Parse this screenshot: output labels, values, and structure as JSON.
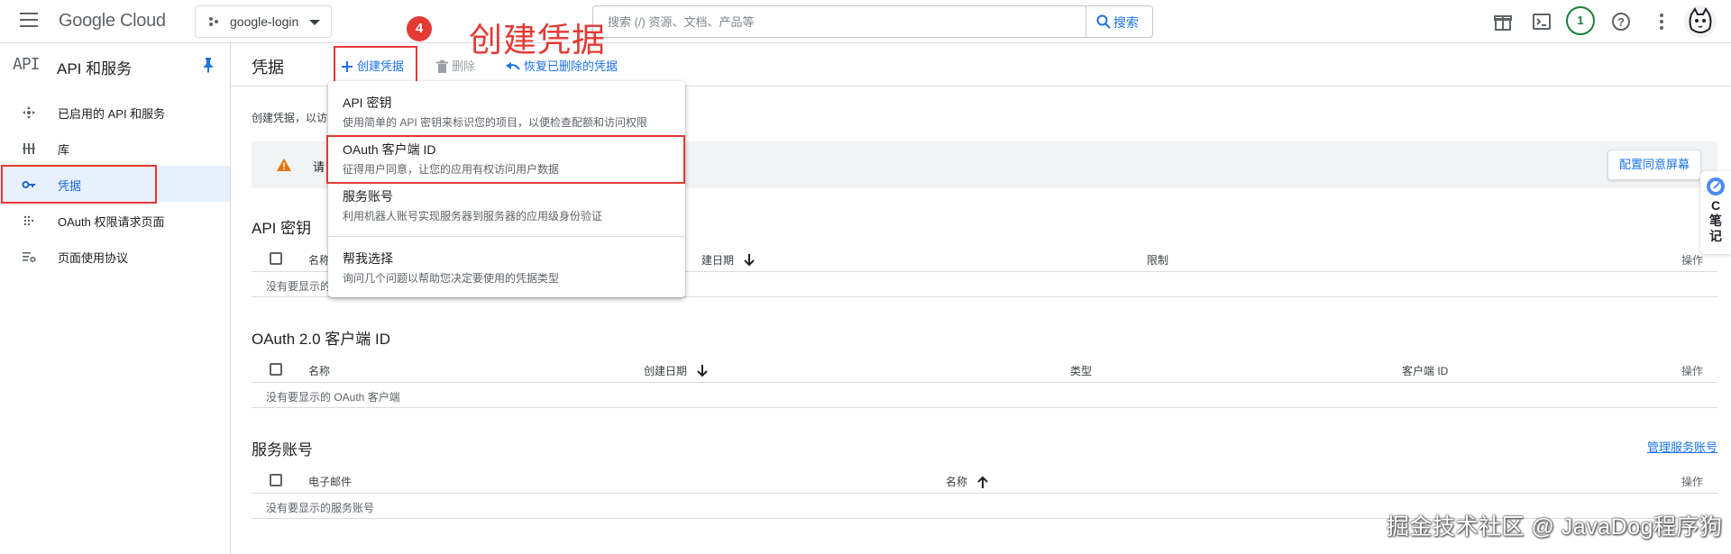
{
  "topbar": {
    "logo_google": "Google",
    "logo_cloud": "Cloud",
    "project_name": "google-login",
    "search_placeholder": "搜索 (/) 资源、文档、产品等",
    "search_button": "搜索",
    "notification_count": "1"
  },
  "sidebar": {
    "logo": "API",
    "title": "API 和服务",
    "items": [
      {
        "label": "已启用的 API 和服务",
        "icon": "diamond-arrows-icon"
      },
      {
        "label": "库",
        "icon": "library-grid-icon"
      },
      {
        "label": "凭据",
        "icon": "key-icon",
        "active": true
      },
      {
        "label": "OAuth 权限请求页面",
        "icon": "dots-grid-icon"
      },
      {
        "label": "页面使用协议",
        "icon": "settings-list-icon"
      }
    ]
  },
  "main": {
    "page_title": "凭据",
    "toolbar": {
      "create_label": "创建凭据",
      "delete_label": "删除",
      "restore_label": "恢复已删除的凭据"
    },
    "intro_text": "创建凭据，以访",
    "warning_text": "请",
    "consent_button": "配置同意屏幕",
    "api_keys": {
      "title": "API 密钥",
      "columns": [
        "名称",
        "建日期",
        "限制"
      ],
      "ops": "操作",
      "empty": "没有要显示的"
    },
    "oauth": {
      "title": "OAuth 2.0 客户端 ID",
      "columns": [
        "名称",
        "创建日期",
        "类型",
        "客户端 ID"
      ],
      "ops": "操作",
      "empty": "没有要显示的 OAuth 客户端"
    },
    "service_accounts": {
      "title": "服务账号",
      "manage_link": "管理服务账号",
      "columns": [
        "电子邮件",
        "名称"
      ],
      "ops": "操作",
      "empty": "没有要显示的服务账号"
    }
  },
  "dropdown": {
    "items": [
      {
        "title": "API 密钥",
        "desc": "使用简单的 API 密钥来标识您的项目，以便检查配额和访问权限"
      },
      {
        "title": "OAuth 客户端 ID",
        "desc": "征得用户同意，让您的应用有权访问用户数据"
      },
      {
        "title": "服务账号",
        "desc": "利用机器人账号实现服务器到服务器的应用级身份验证"
      },
      {
        "title": "帮我选择",
        "desc": "询问几个问题以帮助您决定要使用的凭据类型"
      }
    ]
  },
  "annotation": {
    "step_number": "4",
    "text": "创建凭据"
  },
  "float_widget": {
    "lines": [
      "C",
      "笔",
      "记"
    ]
  },
  "watermark": "掘金技术社区 @ JavaDog程序狗",
  "colors": {
    "accent": "#1a73e8",
    "annotation_red": "#e53935",
    "active_bg": "#e8f0fe",
    "warning": "#e37400"
  }
}
